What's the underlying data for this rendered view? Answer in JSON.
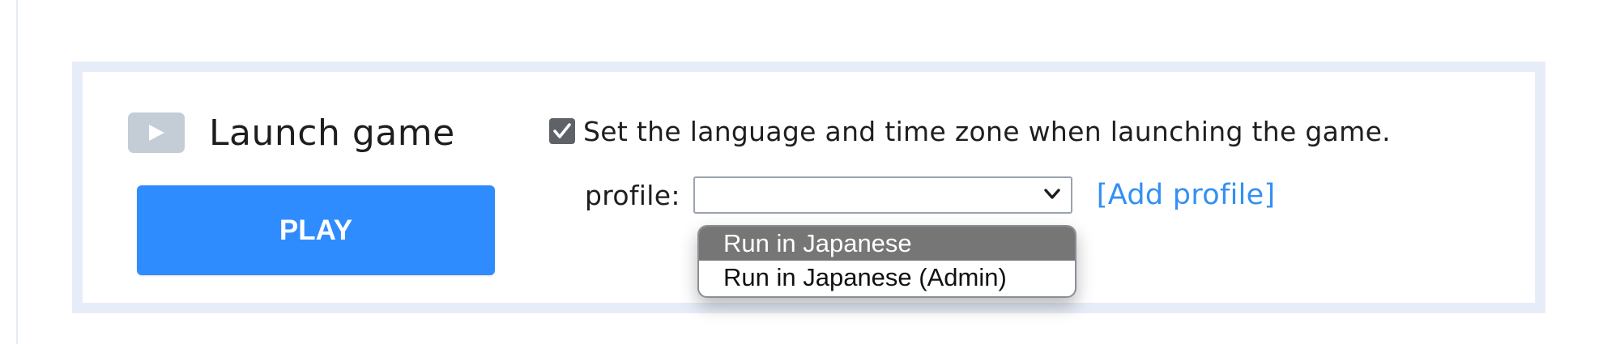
{
  "launch": {
    "title": "Launch game",
    "icon": "play-icon",
    "play_label": "PLAY"
  },
  "options": {
    "set_locale_checked": true,
    "set_locale_label": "Set the language and time zone when launching the game."
  },
  "profile": {
    "label": "profile:",
    "selected_value": "",
    "add_link": "[Add profile]",
    "dropdown_open": true,
    "options": [
      {
        "label": "Run in Japanese",
        "highlighted": true
      },
      {
        "label": "Run in Japanese (Admin)",
        "highlighted": false
      }
    ]
  },
  "colors": {
    "accent": "#2f8cff",
    "link": "#3390f3",
    "panel_border": "#e7edf8",
    "option_highlight": "#767676"
  }
}
